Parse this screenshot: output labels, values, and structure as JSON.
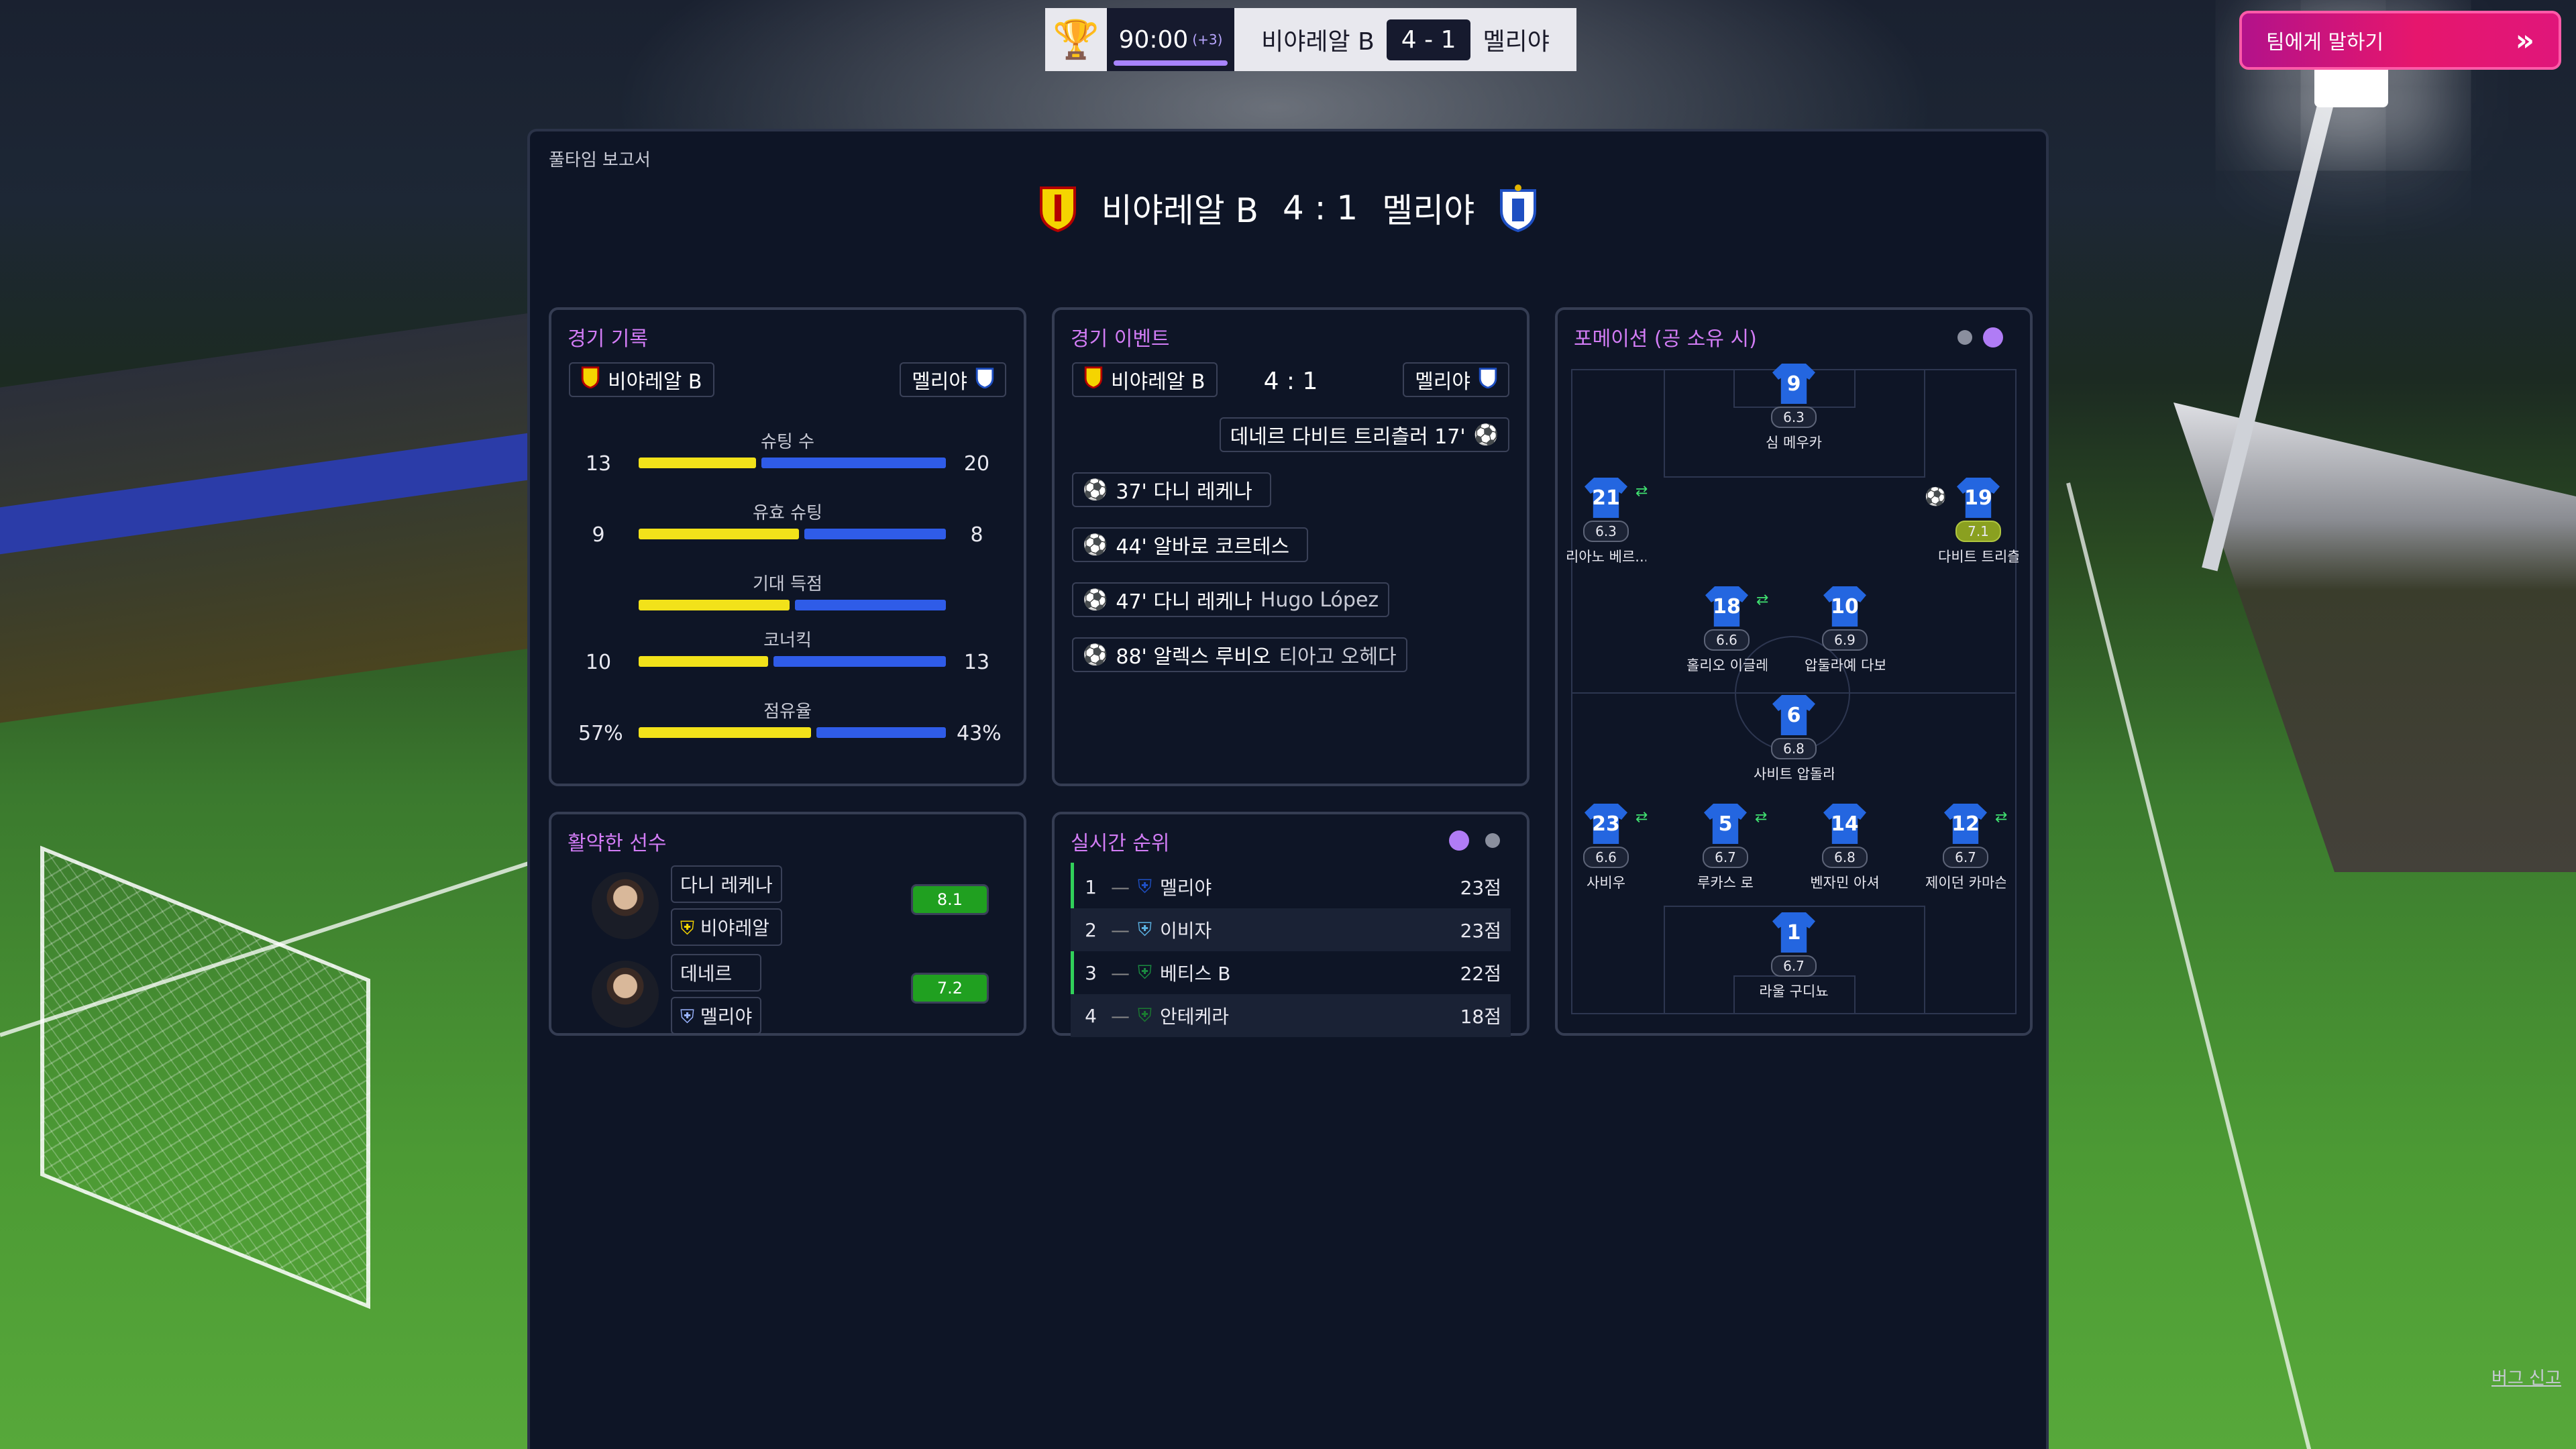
{
  "scoreboard": {
    "time": "90:00",
    "added_time": "(+3)",
    "home": "비야레알 B",
    "score": "4 - 1",
    "away": "멜리야",
    "talk_button": "팀에게 말하기"
  },
  "panel": {
    "title": "풀타임 보고서",
    "home": "비야레알 B",
    "score": "4 : 1",
    "away": "멜리야"
  },
  "match_stats": {
    "title": "경기 기록",
    "home": "비야레알 B",
    "away": "멜리야",
    "rows": [
      {
        "label": "슈팅 수",
        "home": "13",
        "away": "20",
        "home_share": 0.39
      },
      {
        "label": "유효 슈팅",
        "home": "9",
        "away": "8",
        "home_share": 0.53
      },
      {
        "label": "기대 득점",
        "home": "",
        "away": "",
        "home_share": 0.5
      },
      {
        "label": "코너킥",
        "home": "10",
        "away": "13",
        "home_share": 0.43
      },
      {
        "label": "점유율",
        "home": "57%",
        "away": "43%",
        "home_share": 0.57
      }
    ]
  },
  "events": {
    "title": "경기 이벤트",
    "home": "비야레알 B",
    "score": "4 : 1",
    "away": "멜리야",
    "away_goal": "데네르 다비트 트리츨러 17'",
    "home_goals": [
      {
        "text": "37' 다니 레케나",
        "assist": ""
      },
      {
        "text": "44' 알바로 코르테스",
        "assist": ""
      },
      {
        "text": "47' 다니 레케나",
        "assist": "Hugo López"
      },
      {
        "text": "88' 알렉스 루비오",
        "assist": "티아고 오헤다"
      }
    ]
  },
  "best_players": {
    "title": "활약한 선수",
    "players": [
      {
        "name": "다니 레케나",
        "team": "비야레알",
        "rating": "8.1"
      },
      {
        "name": "데네르",
        "team": "멜리야",
        "rating": "7.2"
      }
    ]
  },
  "live_table": {
    "title": "실시간 순위",
    "rows": [
      {
        "pos": "1",
        "team": "멜리야",
        "pts": "23점"
      },
      {
        "pos": "2",
        "team": "이비자",
        "pts": "23점"
      },
      {
        "pos": "3",
        "team": "베티스 B",
        "pts": "22점"
      },
      {
        "pos": "4",
        "team": "안테케라",
        "pts": "18점"
      }
    ]
  },
  "formation": {
    "title": "포메이션 (공 소유 시)",
    "players": [
      {
        "num": "9",
        "rating": "6.3",
        "name": "심 메우카"
      },
      {
        "num": "21",
        "rating": "6.3",
        "name": "리아노 베르..."
      },
      {
        "num": "19",
        "rating": "7.1",
        "name": "다비트 트리츨러"
      },
      {
        "num": "18",
        "rating": "6.6",
        "name": "홀리오 이글레..."
      },
      {
        "num": "10",
        "rating": "6.9",
        "name": "압둘라예 다보"
      },
      {
        "num": "6",
        "rating": "6.8",
        "name": "사비트 압돌라이"
      },
      {
        "num": "23",
        "rating": "6.6",
        "name": "사비우"
      },
      {
        "num": "5",
        "rating": "6.7",
        "name": "루카스 로"
      },
      {
        "num": "14",
        "rating": "6.8",
        "name": "벤자민 아셔"
      },
      {
        "num": "12",
        "rating": "6.7",
        "name": "제이던 카마슨"
      },
      {
        "num": "1",
        "rating": "6.7",
        "name": "라울 구디뇨"
      }
    ]
  },
  "footer": {
    "bug_report": "버그 신고"
  },
  "colors": {
    "home_bar": "#f2e21a",
    "away_bar": "#2f5ce8",
    "accent": "#d27cf5",
    "talk_button": "#e0167a"
  }
}
